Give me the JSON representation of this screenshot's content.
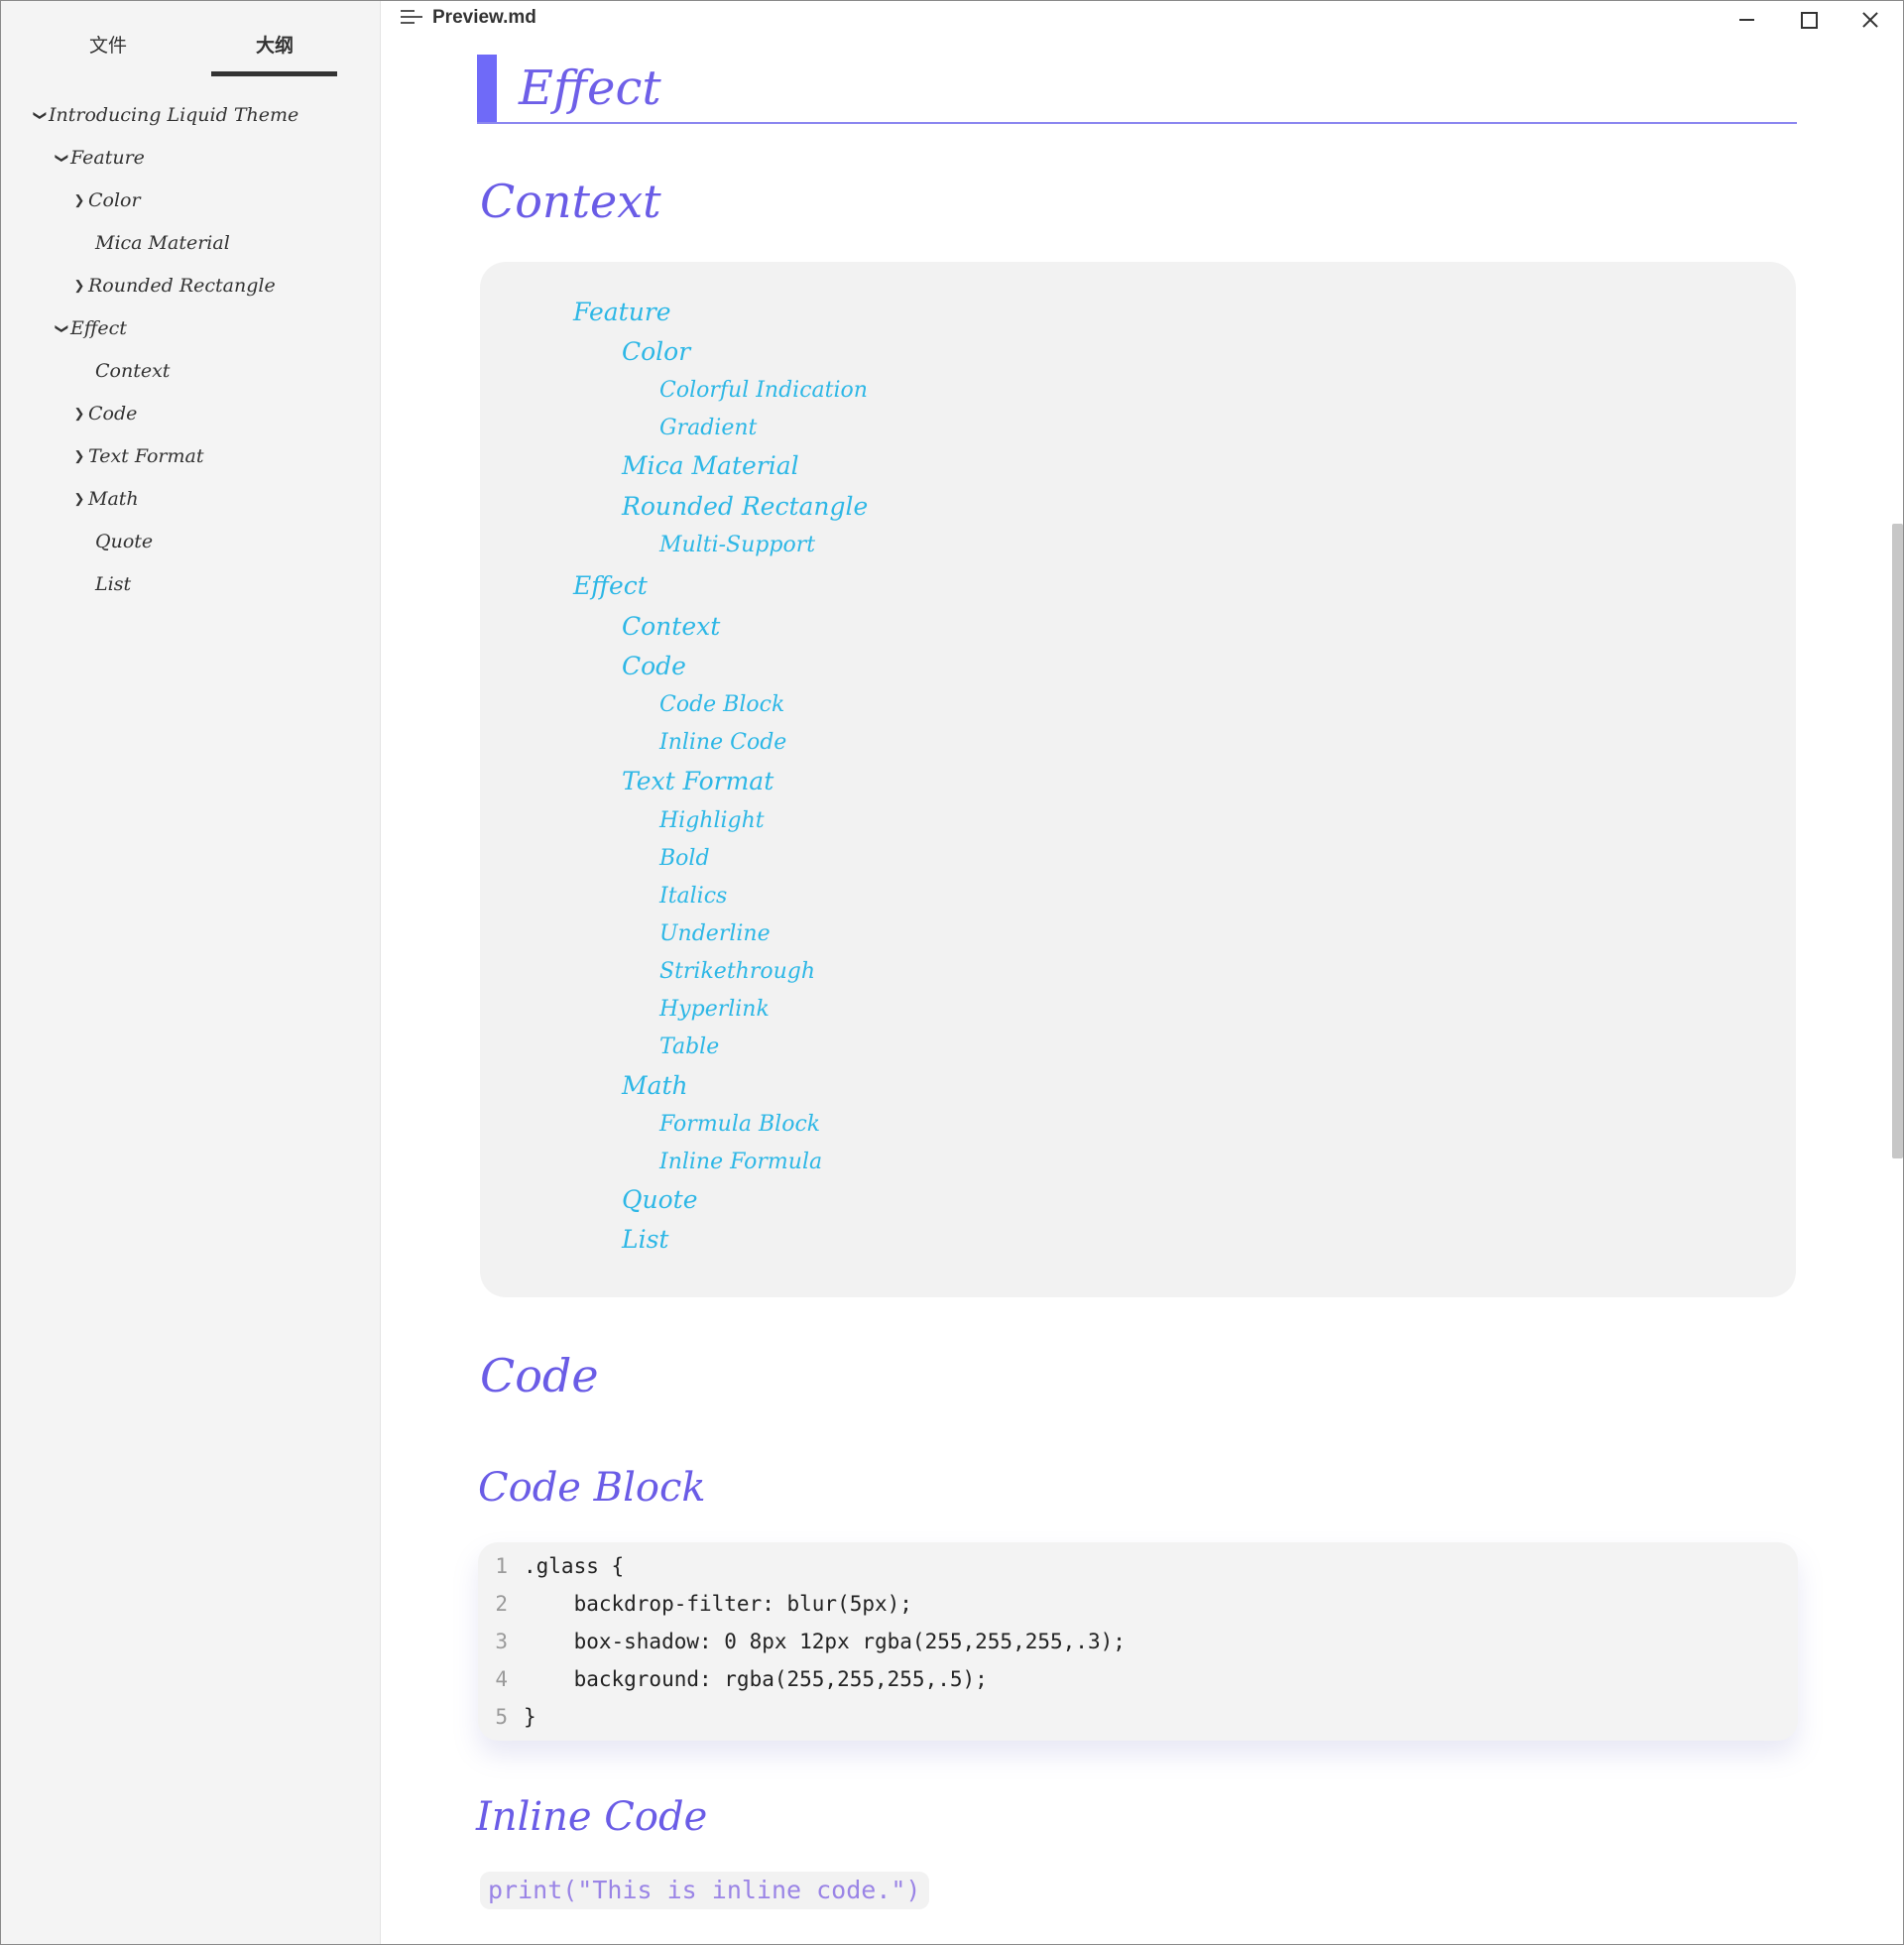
{
  "sidebar": {
    "tabs": {
      "files": "文件",
      "outline": "大纲"
    },
    "outline": [
      {
        "label": "Introducing Liquid Theme",
        "chevron": "down"
      },
      {
        "label": "Feature",
        "chevron": "down"
      },
      {
        "label": "Color",
        "chevron": "right"
      },
      {
        "label": "Mica Material",
        "chevron": ""
      },
      {
        "label": "Rounded Rectangle",
        "chevron": "right"
      },
      {
        "label": "Effect",
        "chevron": "down"
      },
      {
        "label": "Context",
        "chevron": ""
      },
      {
        "label": "Code",
        "chevron": "right"
      },
      {
        "label": "Text Format",
        "chevron": "right"
      },
      {
        "label": "Math",
        "chevron": "right"
      },
      {
        "label": "Quote",
        "chevron": ""
      },
      {
        "label": "List",
        "chevron": ""
      }
    ]
  },
  "titlebar": {
    "title": "Preview.md",
    "icons": {
      "doc": "document-lines-icon",
      "minimize": "minimize-icon",
      "maximize": "maximize-icon",
      "close": "close-icon"
    }
  },
  "content": {
    "h1": "Effect",
    "context_heading": "Context",
    "toc": [
      {
        "label": "Feature",
        "level": 1
      },
      {
        "label": "Color",
        "level": 2
      },
      {
        "label": "Colorful Indication",
        "level": 3
      },
      {
        "label": "Gradient",
        "level": 3
      },
      {
        "label": "Mica Material",
        "level": 2
      },
      {
        "label": "Rounded Rectangle",
        "level": 2
      },
      {
        "label": "Multi-Support",
        "level": 3
      },
      {
        "label": "Effect",
        "level": 1
      },
      {
        "label": "Context",
        "level": 2
      },
      {
        "label": "Code",
        "level": 2
      },
      {
        "label": "Code Block",
        "level": 3
      },
      {
        "label": "Inline Code",
        "level": 3
      },
      {
        "label": "Text Format",
        "level": 2
      },
      {
        "label": "Highlight",
        "level": 3
      },
      {
        "label": "Bold",
        "level": 3
      },
      {
        "label": "Italics",
        "level": 3
      },
      {
        "label": "Underline",
        "level": 3
      },
      {
        "label": "Strikethrough",
        "level": 3
      },
      {
        "label": "Hyperlink",
        "level": 3
      },
      {
        "label": "Table",
        "level": 3
      },
      {
        "label": "Math",
        "level": 2
      },
      {
        "label": "Formula Block",
        "level": 3
      },
      {
        "label": "Inline Formula",
        "level": 3
      },
      {
        "label": "Quote",
        "level": 2
      },
      {
        "label": "List",
        "level": 2
      }
    ],
    "code_heading": "Code",
    "code_block_heading": "Code Block",
    "code_lines": [
      {
        "n": "1",
        "text": ".glass {"
      },
      {
        "n": "2",
        "text": "    backdrop-filter: blur(5px);"
      },
      {
        "n": "3",
        "text": "    box-shadow: 0 8px 12px rgba(255,255,255,.3);"
      },
      {
        "n": "4",
        "text": "    background: rgba(255,255,255,.5);"
      },
      {
        "n": "5",
        "text": "}"
      }
    ],
    "inline_code_heading": "Inline Code",
    "inline_code": "print(\"This is inline code.\")"
  },
  "colors": {
    "heading": "#6a5ce6",
    "toc_link": "#2db7e6",
    "accent_bar": "#6f6af8",
    "inline_code": "#9a84e6",
    "sidebar_bg": "#f4f4f4"
  }
}
